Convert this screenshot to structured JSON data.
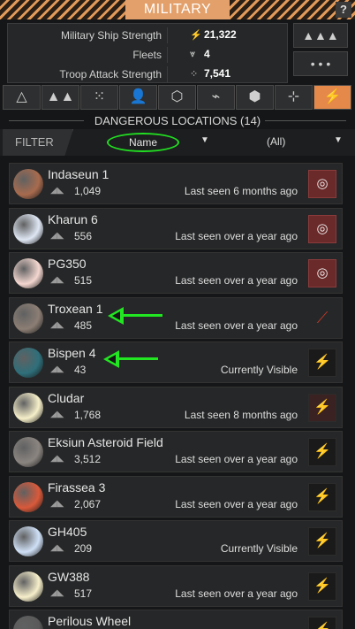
{
  "window": {
    "title": "MILITARY",
    "help_label": "?"
  },
  "stats": [
    {
      "label": "Military Ship Strength",
      "value": "21,322",
      "icon": "lightning-icon"
    },
    {
      "label": "Fleets",
      "value": "4",
      "icon": "fleet-icon"
    },
    {
      "label": "Troop Attack Strength",
      "value": "7,541",
      "icon": "troops-icon"
    }
  ],
  "side_buttons": [
    {
      "name": "fleet-formation-button",
      "glyph": "▲▲▲"
    },
    {
      "name": "troops-formation-button",
      "glyph": "• • •"
    }
  ],
  "tabs": [
    {
      "name": "tab-overview",
      "glyph": "△"
    },
    {
      "name": "tab-fleets",
      "glyph": "▲▲"
    },
    {
      "name": "tab-troops",
      "glyph": "⁙"
    },
    {
      "name": "tab-people",
      "glyph": "👤"
    },
    {
      "name": "tab-defense",
      "glyph": "⬡"
    },
    {
      "name": "tab-health",
      "glyph": "⌁"
    },
    {
      "name": "tab-repair",
      "glyph": "⬢"
    },
    {
      "name": "tab-targeting",
      "glyph": "⊹"
    },
    {
      "name": "tab-dangerous-locations",
      "glyph": "⚡"
    }
  ],
  "section_header": "DANGEROUS LOCATIONS (14)",
  "filter": {
    "filter_label": "FILTER",
    "sort_value": "Name",
    "type_value": "(All)"
  },
  "locations": [
    {
      "name": "Indaseun 1",
      "strength": "1,049",
      "seen": "Last seen 6 months ago",
      "planet_color": "#a86b4e",
      "action": "target"
    },
    {
      "name": "Kharun 6",
      "strength": "556",
      "seen": "Last seen over a year ago",
      "planet_color": "#dfe7f4",
      "action": "target"
    },
    {
      "name": "PG350",
      "strength": "515",
      "seen": "Last seen over a year ago",
      "planet_color": "#f3d6cf",
      "action": "target"
    },
    {
      "name": "Troxean 1",
      "strength": "485",
      "seen": "Last seen over a year ago",
      "planet_color": "#8c7e74",
      "action": "ship"
    },
    {
      "name": "Bispen 4",
      "strength": "43",
      "seen": "Currently Visible",
      "planet_color": "#2f6f7a",
      "action": "attack"
    },
    {
      "name": "Cludar",
      "strength": "1,768",
      "seen": "Last seen 8 months ago",
      "planet_color": "#f6efc9",
      "action": "attack-highlight"
    },
    {
      "name": "Eksiun Asteroid Field",
      "strength": "3,512",
      "seen": "Last seen over a year ago",
      "planet_color": "#8b8580",
      "action": "attack"
    },
    {
      "name": "Firassea 3",
      "strength": "2,067",
      "seen": "Last seen over a year ago",
      "planet_color": "#d9593a",
      "action": "attack"
    },
    {
      "name": "GH405",
      "strength": "209",
      "seen": "Currently Visible",
      "planet_color": "#cfe0f6",
      "action": "attack"
    },
    {
      "name": "GW388",
      "strength": "517",
      "seen": "Last seen over a year ago",
      "planet_color": "#f7efcb",
      "action": "attack"
    },
    {
      "name": "Perilous Wheel",
      "strength": "",
      "seen": "",
      "planet_color": "#5a5a5a",
      "action": "attack"
    }
  ]
}
